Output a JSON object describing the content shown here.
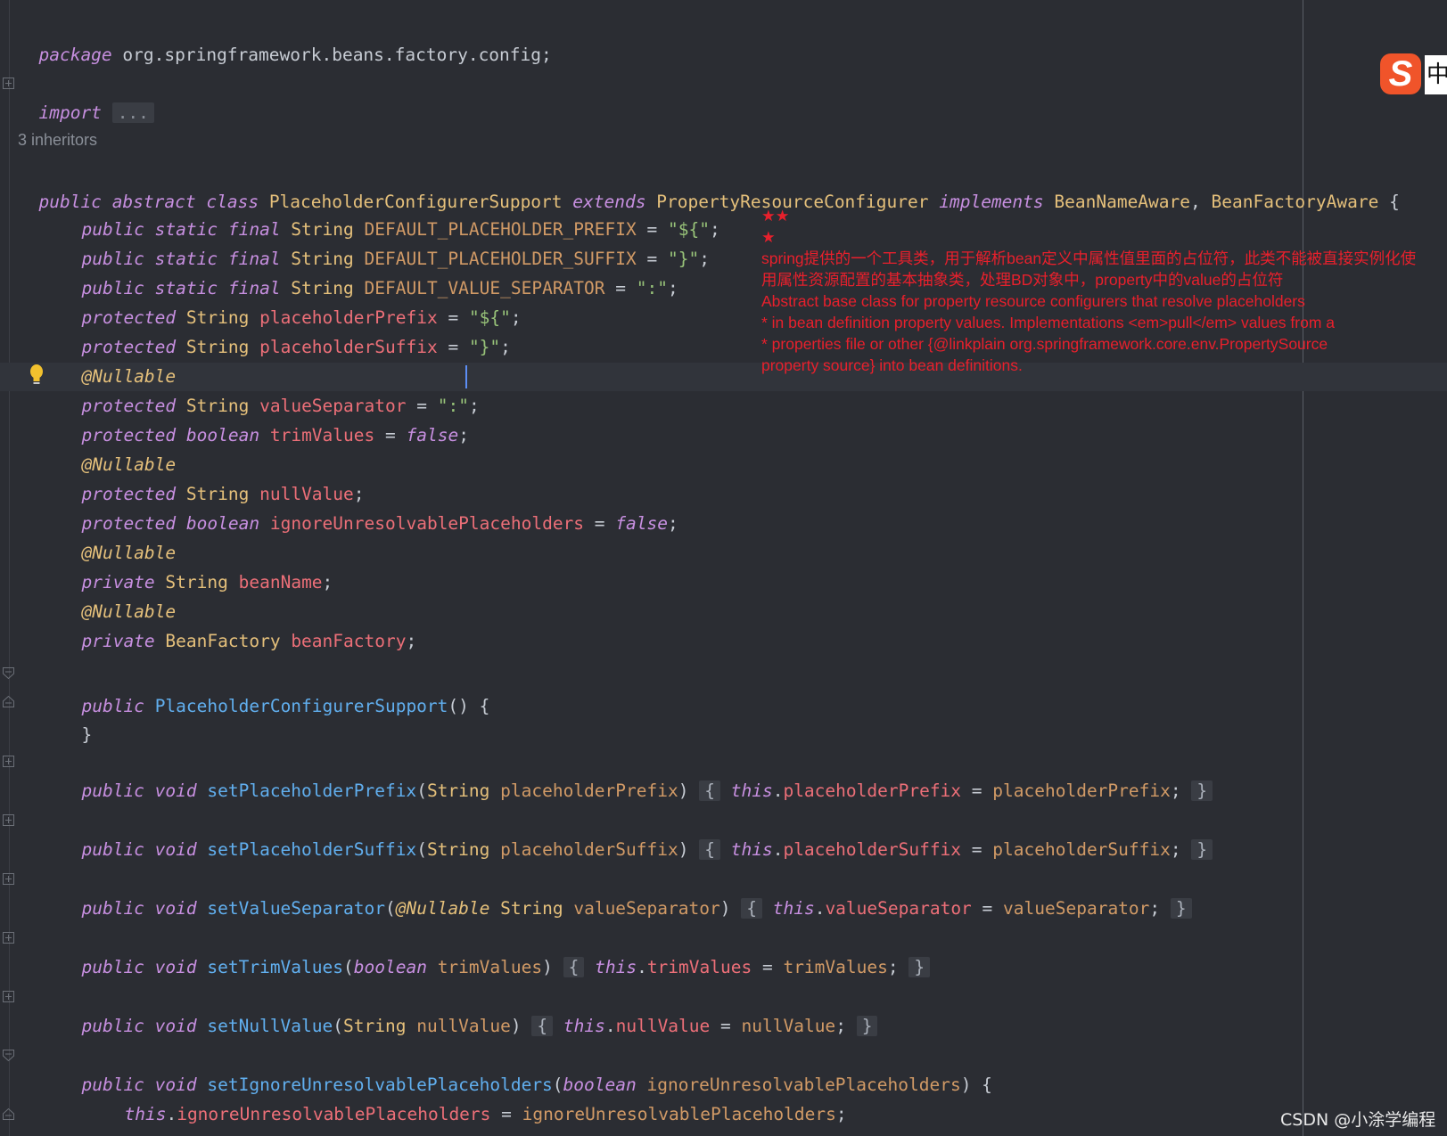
{
  "editor": {
    "package_line": {
      "kw": "package",
      "name": " org.springframework.beans.factory.config;"
    },
    "import_line": {
      "kw": "import",
      "fold": "..."
    },
    "inheritors": "3 inheritors",
    "class_decl": {
      "k1": "public",
      "k2": "abstract",
      "k3": "class",
      "name": "PlaceholderConfigurerSupport",
      "k4": "extends",
      "parent": "PropertyResourceConfigurer",
      "k5": "implements",
      "i1": "BeanNameAware",
      "sep": ", ",
      "i2": "BeanFactoryAware",
      "brace": " {"
    },
    "const1": {
      "mods": "public static final",
      "type": "String",
      "name": "DEFAULT_PLACEHOLDER_PREFIX",
      "eq": " = ",
      "val": "\"${\"",
      "end": ";"
    },
    "const2": {
      "mods": "public static final",
      "type": "String",
      "name": "DEFAULT_PLACEHOLDER_SUFFIX",
      "eq": " = ",
      "val": "\"}\"",
      "end": ";"
    },
    "const3": {
      "mods": "public static final",
      "type": "String",
      "name": "DEFAULT_VALUE_SEPARATOR",
      "eq": " = ",
      "val": "\":\"",
      "end": ";"
    },
    "field_prefix": {
      "mod": "protected",
      "type": "String",
      "name": "placeholderPrefix",
      "eq": " = ",
      "val": "\"${\"",
      "end": ";"
    },
    "field_suffix": {
      "mod": "protected",
      "type": "String",
      "name": "placeholderSuffix",
      "eq": " = ",
      "val": "\"}\"",
      "end": ";"
    },
    "annotation": "@Nullable",
    "field_separator": {
      "mod": "protected",
      "type": "String",
      "name": "valueSeparator",
      "eq": " = ",
      "val": "\":\"",
      "end": ";"
    },
    "field_trim": {
      "mod": "protected",
      "type": "boolean",
      "name": "trimValues",
      "eq": " = ",
      "val": "false",
      "end": ";"
    },
    "field_null": {
      "mod": "protected",
      "type": "String",
      "name": "nullValue",
      "end": ";"
    },
    "field_ignore": {
      "mod": "protected",
      "type": "boolean",
      "name": "ignoreUnresolvablePlaceholders",
      "eq": " = ",
      "val": "false",
      "end": ";"
    },
    "field_beanname": {
      "mod": "private",
      "type": "String",
      "name": "beanName",
      "end": ";"
    },
    "field_beanfactory": {
      "mod": "private",
      "type": "BeanFactory",
      "name": "beanFactory",
      "end": ";"
    },
    "ctor": {
      "mod": "public",
      "name": "PlaceholderConfigurerSupport",
      "rest": "() {"
    },
    "close_brace": "}",
    "set_prefix": {
      "mods": "public void",
      "name": "setPlaceholderPrefix",
      "open": "(",
      "ptype": "String",
      "pname": "placeholderPrefix",
      "close": ")",
      "lb": "{",
      "this": "this",
      "dot": ".",
      "field": "placeholderPrefix",
      "eq": " = ",
      "rhs": "placeholderPrefix",
      "semi": ";",
      "rb": "}"
    },
    "set_suffix": {
      "mods": "public void",
      "name": "setPlaceholderSuffix",
      "open": "(",
      "ptype": "String",
      "pname": "placeholderSuffix",
      "close": ")",
      "lb": "{",
      "this": "this",
      "dot": ".",
      "field": "placeholderSuffix",
      "eq": " = ",
      "rhs": "placeholderSuffix",
      "semi": ";",
      "rb": "}"
    },
    "set_separator": {
      "mods": "public void",
      "name": "setValueSeparator",
      "open": "(",
      "ann": "@Nullable",
      "ptype": "String",
      "pname": "valueSeparator",
      "close": ")",
      "lb": "{",
      "this": "this",
      "dot": ".",
      "field": "valueSeparator",
      "eq": " = ",
      "rhs": "valueSeparator",
      "semi": ";",
      "rb": "}"
    },
    "set_trim": {
      "mods": "public void",
      "name": "setTrimValues",
      "open": "(",
      "ptype": "boolean",
      "pname": "trimValues",
      "close": ")",
      "lb": "{",
      "this": "this",
      "dot": ".",
      "field": "trimValues",
      "eq": " = ",
      "rhs": "trimValues",
      "semi": ";",
      "rb": "}"
    },
    "set_null": {
      "mods": "public void",
      "name": "setNullValue",
      "open": "(",
      "ptype": "String",
      "pname": "nullValue",
      "close": ")",
      "lb": "{",
      "this": "this",
      "dot": ".",
      "field": "nullValue",
      "eq": " = ",
      "rhs": "nullValue",
      "semi": ";",
      "rb": "}"
    },
    "set_ignore": {
      "mods": "public void",
      "name": "setIgnoreUnresolvablePlaceholders",
      "open": "(",
      "ptype": "boolean",
      "pname": "ignoreUnresolvablePlaceholders",
      "close": ") {"
    },
    "ignore_body": {
      "this": "this",
      "dot": ".",
      "field": "ignoreUnresolvablePlaceholders",
      "eq": " = ",
      "rhs": "ignoreUnresolvablePlaceholders",
      "semi": ";"
    }
  },
  "note": {
    "stars1": "★★",
    "stars2": "★",
    "line1": "spring提供的一个工具类，用于解析bean定义中属性值里面的占位符，此类不能被直接实例化使",
    "line2": "用属性资源配置的基本抽象类，处理BD对象中，property中的value的占位符",
    "line3": "Abstract base class for property resource configurers that resolve placeholders",
    "line4": "* in bean definition property values. Implementations <em>pull</em> values from a",
    "line5": "* properties file or other {@linkplain org.springframework.core.env.PropertySource",
    "line6": "property source} into bean definitions."
  },
  "ime": {
    "logo": "S",
    "mode": "中"
  },
  "watermark": "CSDN @小涂学编程",
  "colors": {
    "background": "#2b2d33",
    "keyword": "#c78fe0",
    "type": "#e5c07b",
    "field": "#ec6f78",
    "string": "#98c379",
    "method": "#61afef",
    "note": "#e8202c"
  }
}
